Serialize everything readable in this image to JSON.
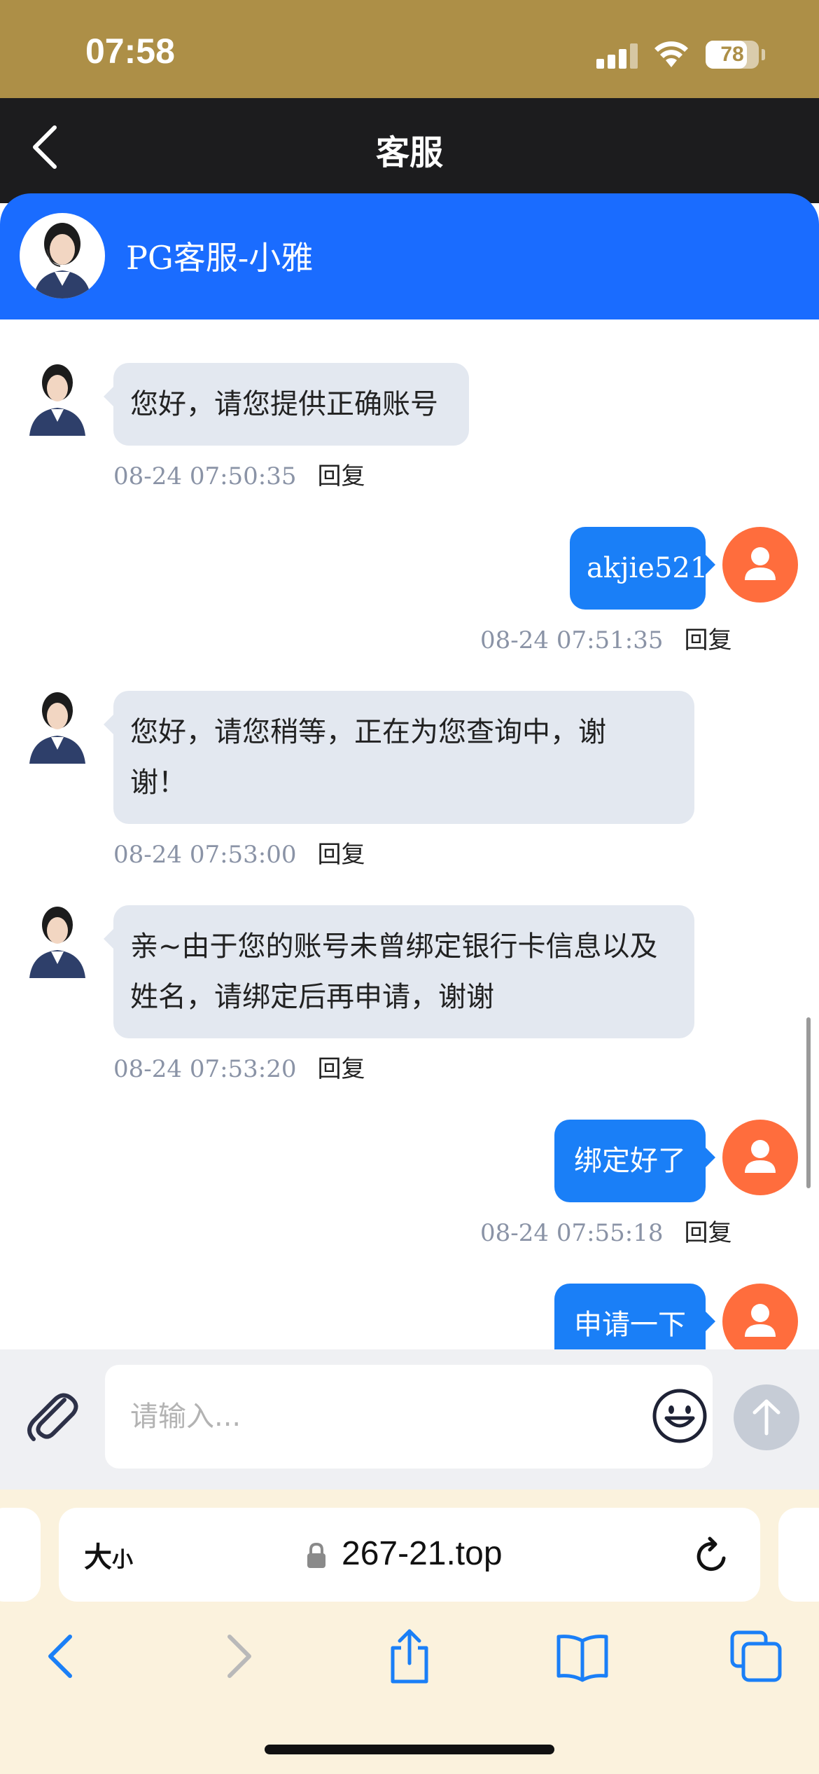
{
  "status_bar": {
    "time": "07:58",
    "battery": "78",
    "battery_level": 0.78
  },
  "nav": {
    "title": "客服"
  },
  "agent": {
    "name": "PG客服-小雅"
  },
  "messages": [
    {
      "side": "in",
      "lines": [
        "您好，请您提供正确账号"
      ],
      "timestamp": "08-24 07:50:35",
      "reply": "回复"
    },
    {
      "side": "out",
      "lines": [
        "akjie521"
      ],
      "timestamp": "08-24 07:51:35",
      "reply": "回复"
    },
    {
      "side": "in",
      "lines": [
        "您好，请您稍等，正在为您查询中，谢",
        "谢！"
      ],
      "timestamp": "08-24 07:53:00",
      "reply": "回复"
    },
    {
      "side": "in",
      "lines": [
        "亲~由于您的账号未曾绑定银行卡信息以及",
        "姓名，请绑定后再申请，谢谢"
      ],
      "timestamp": "08-24 07:53:20",
      "reply": "回复"
    },
    {
      "side": "out",
      "lines": [
        "绑定好了"
      ],
      "timestamp": "08-24 07:55:18",
      "reply": "回复"
    },
    {
      "side": "out",
      "lines": [
        "申请一下"
      ]
    }
  ],
  "input": {
    "placeholder": "请输入..."
  },
  "safari": {
    "size_label": "大",
    "size_label_small": "小",
    "url": "267-21.top"
  },
  "colors": {
    "header_blue": "#1a6cff",
    "bubble_out": "#1a7ff7",
    "bubble_in": "#e3e8f0",
    "user_avatar": "#ff6d3d",
    "status_bar": "#ad8f47"
  }
}
